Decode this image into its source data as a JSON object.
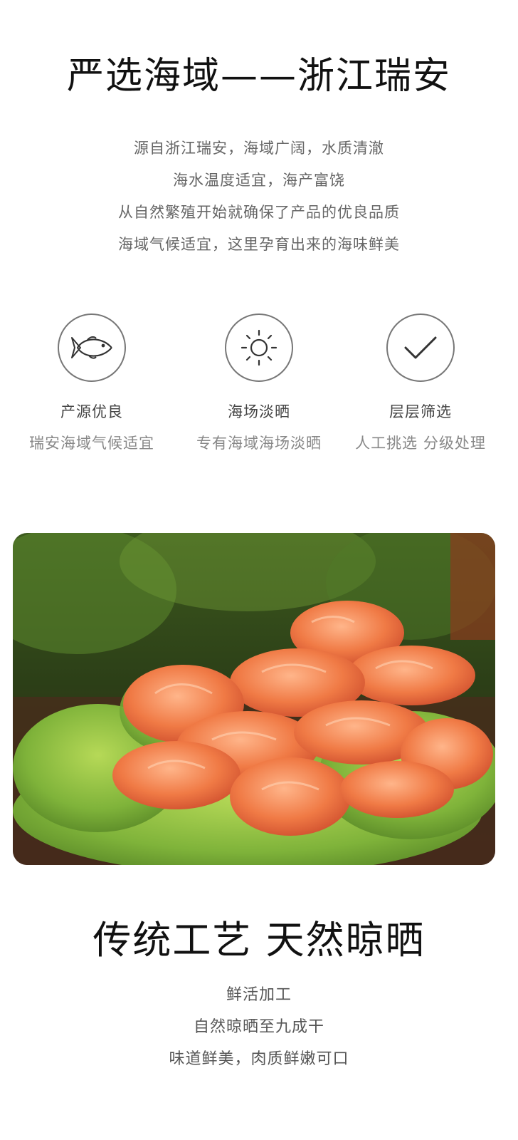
{
  "section1": {
    "title": "严选海域——浙江瑞安",
    "lines": [
      "源自浙江瑞安，海域广阔，水质清澈",
      "海水温度适宜，海产富饶",
      "从自然繁殖开始就确保了产品的优良品质",
      "海域气候适宜，这里孕育出来的海味鲜美"
    ]
  },
  "features": [
    {
      "icon": "fish-icon",
      "title": "产源优良",
      "subtitle": "瑞安海域气候适宜"
    },
    {
      "icon": "sun-icon",
      "title": "海场淡晒",
      "subtitle": "专有海域海场淡晒"
    },
    {
      "icon": "checkmark-icon",
      "title": "层层筛选",
      "subtitle": "人工挑选 分级处理"
    }
  ],
  "section2": {
    "title": "传统工艺 天然晾晒",
    "lines": [
      "鲜活加工",
      "自然晾晒至九成干",
      "味道鲜美，肉质鲜嫩可口"
    ]
  }
}
